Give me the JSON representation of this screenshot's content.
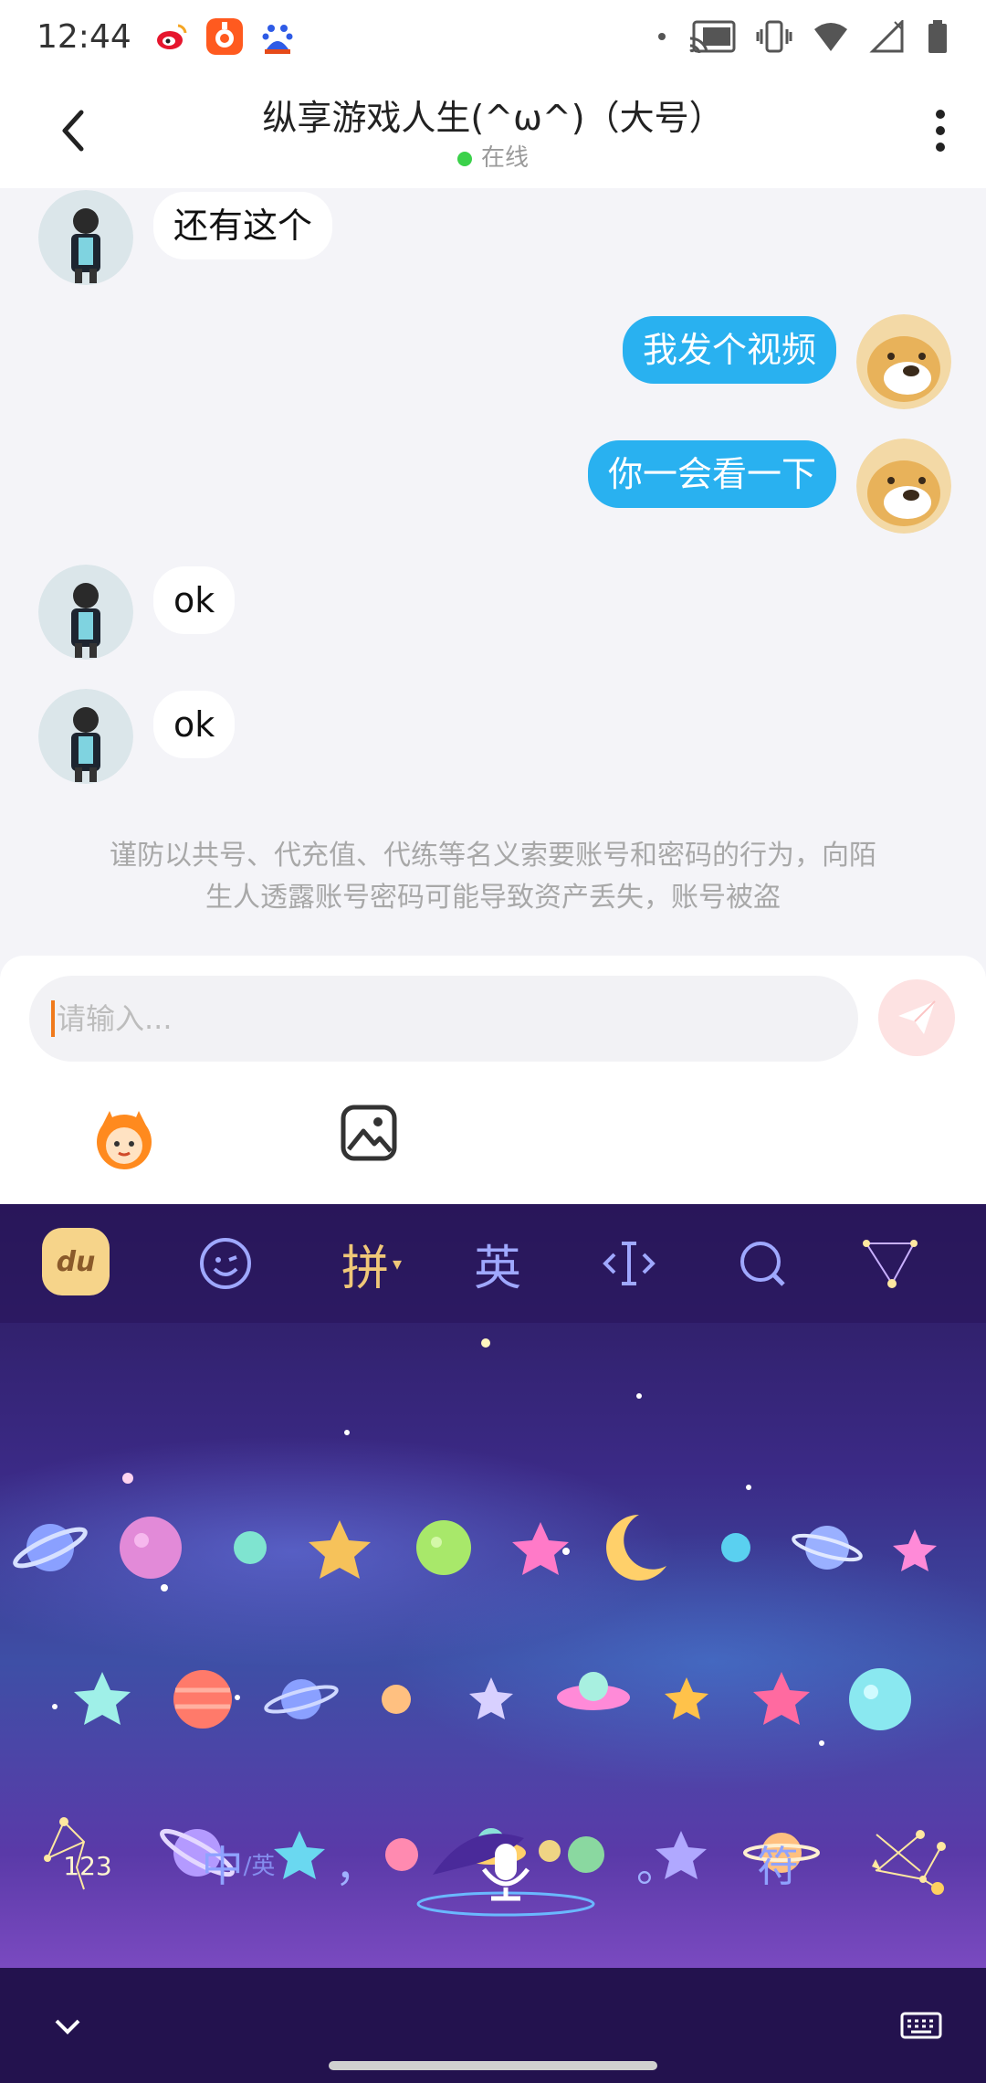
{
  "status_bar": {
    "time": "12:44"
  },
  "header": {
    "title": "纵享游戏人生(^ω^)（大号）",
    "online_status": "在线"
  },
  "messages": [
    {
      "from": "other",
      "text": "还有这个"
    },
    {
      "from": "me",
      "text": "我发个视频"
    },
    {
      "from": "me",
      "text": "你一会看一下"
    },
    {
      "from": "other",
      "text": "ok"
    },
    {
      "from": "other",
      "text": "ok"
    }
  ],
  "warning": {
    "line1": "谨防以共号、代充值、代练等名义索要账号和密码的行为，向陌",
    "line2": "生人透露账号密码可能导致资产丢失，账号被盗"
  },
  "composer": {
    "placeholder": "请输入..."
  },
  "keyboard": {
    "logo": "du",
    "pinyin_label": "拼",
    "english_label": "英",
    "num_key": "123",
    "zh_key": "中",
    "en_small": "/英",
    "comma_key": "，",
    "period_key": "。",
    "symbol_key": "符"
  },
  "colors": {
    "outgoing_bubble": "#29b1f0",
    "incoming_bubble": "#ffffff",
    "online_dot": "#3bd14a",
    "send_button_bg": "#fde2e2"
  }
}
